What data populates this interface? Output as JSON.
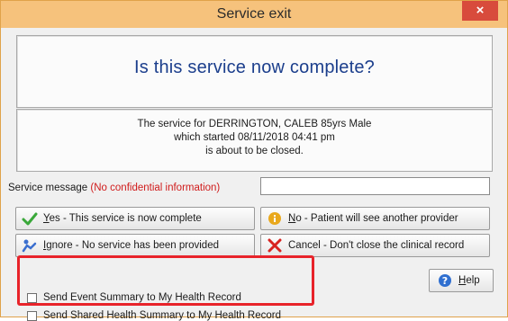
{
  "window": {
    "title": "Service exit",
    "close_label": "×"
  },
  "question": "Is this service now complete?",
  "info": {
    "line1": "The service for DERRINGTON, CALEB 85yrs Male",
    "line2": "which started 08/11/2018 04:41 pm",
    "line3": "is about to be closed."
  },
  "service_message": {
    "label": "Service message",
    "warning": "(No confidential information)",
    "value": ""
  },
  "buttons": {
    "yes": {
      "mnemonic": "Y",
      "rest": "es - This service is now complete",
      "icon": "checkmark-icon"
    },
    "no": {
      "mnemonic": "N",
      "rest": "o - Patient will see another provider",
      "icon": "info-icon"
    },
    "ignore": {
      "mnemonic": "I",
      "rest": "gnore - No service has been provided",
      "icon": "ignore-icon"
    },
    "cancel": {
      "text": "Cancel - Don't close the clinical record",
      "icon": "x-icon"
    },
    "help": {
      "mnemonic": "H",
      "rest": "elp",
      "icon": "help-icon"
    }
  },
  "checkboxes": {
    "event_summary": {
      "label": "Send Event Summary to My Health Record",
      "checked": false
    },
    "shared_health_summary": {
      "label": "Send Shared Health Summary to My Health Record",
      "checked": false
    }
  },
  "colors": {
    "title_bar": "#f6c27c",
    "close_button": "#d84b3c",
    "question_text": "#1b3e8c",
    "warning_text": "#d01b1b",
    "highlight_box": "#e8232a"
  }
}
